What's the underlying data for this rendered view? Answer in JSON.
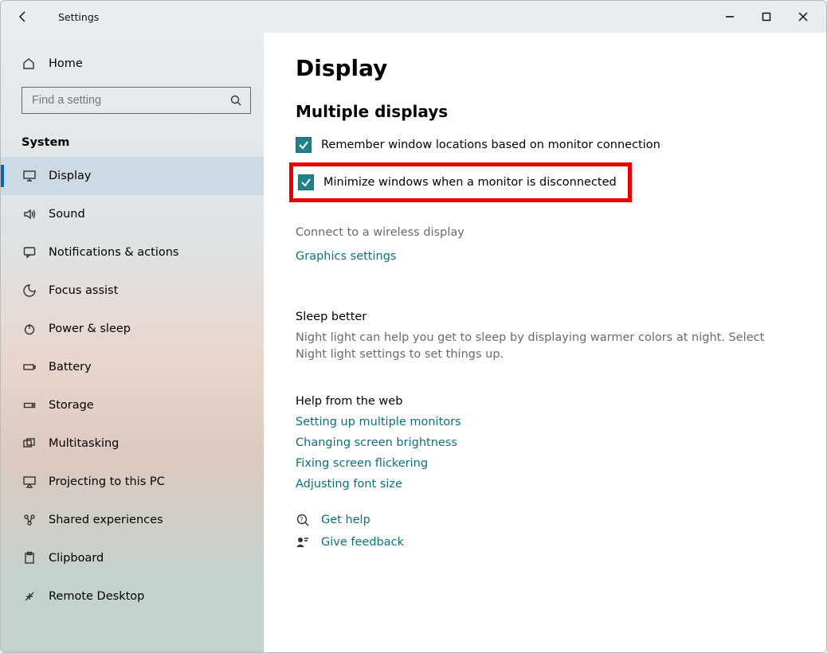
{
  "app_title": "Settings",
  "home_label": "Home",
  "search_placeholder": "Find a setting",
  "section_label": "System",
  "nav": [
    {
      "label": "Display",
      "selected": true
    },
    {
      "label": "Sound"
    },
    {
      "label": "Notifications & actions"
    },
    {
      "label": "Focus assist"
    },
    {
      "label": "Power & sleep"
    },
    {
      "label": "Battery"
    },
    {
      "label": "Storage"
    },
    {
      "label": "Multitasking"
    },
    {
      "label": "Projecting to this PC"
    },
    {
      "label": "Shared experiences"
    },
    {
      "label": "Clipboard"
    },
    {
      "label": "Remote Desktop"
    }
  ],
  "page_title": "Display",
  "group_title": "Multiple displays",
  "checkbox1_label": "Remember window locations based on monitor connection",
  "checkbox2_label": "Minimize windows when a monitor is disconnected",
  "connect_label": "Connect to a wireless display",
  "graphics_label": "Graphics settings",
  "tip_title": "Sleep better",
  "tip_text": "Night light can help you get to sleep by displaying warmer colors at night. Select Night light settings to set things up.",
  "help_title": "Help from the web",
  "help_links": [
    "Setting up multiple monitors",
    "Changing screen brightness",
    "Fixing screen flickering",
    "Adjusting font size"
  ],
  "get_help_label": "Get help",
  "give_feedback_label": "Give feedback"
}
